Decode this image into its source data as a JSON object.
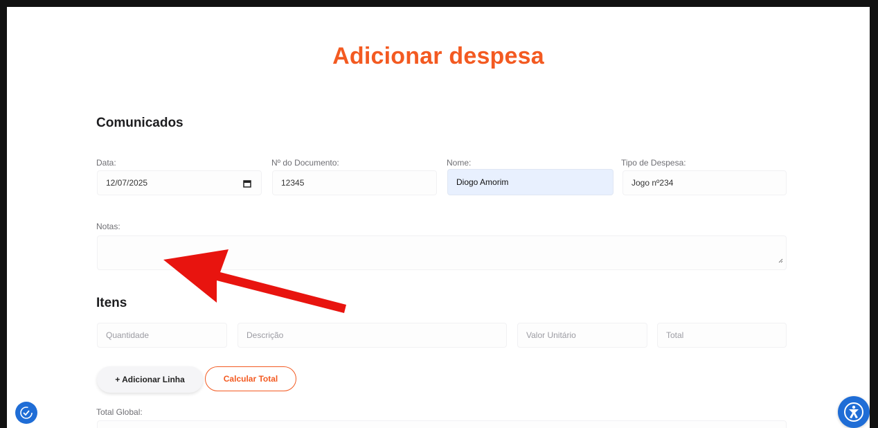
{
  "page": {
    "title": "Adicionar despesa"
  },
  "comunicados": {
    "section_title": "Comunicados",
    "data_label": "Data:",
    "data_value": "12/07/2025",
    "doc_label": "Nº do Documento:",
    "doc_value": "12345",
    "nome_label": "Nome:",
    "nome_value": "Diogo Amorim",
    "tipo_label": "Tipo de Despesa:",
    "tipo_value": "Jogo nº234",
    "notas_label": "Notas:",
    "notas_value": ""
  },
  "itens": {
    "section_title": "Itens",
    "quantidade_placeholder": "Quantidade",
    "descricao_placeholder": "Descrição",
    "valor_unitario_placeholder": "Valor Unitário",
    "total_placeholder": "Total"
  },
  "actions": {
    "add_line_label": "+ Adicionar Linha",
    "calc_total_label": "Calcular Total"
  },
  "total_global": {
    "label": "Total Global:",
    "value": ""
  },
  "icons": {
    "calendar": "calendar-icon",
    "resize": "resize-grip-icon",
    "left_fab": "clock-check-icon",
    "right_fab": "accessibility-icon",
    "annotation": "red-arrow-icon"
  },
  "colors": {
    "accent": "#f35a21",
    "fab_blue": "#1f6dd6",
    "arrow_red": "#e8140f",
    "autofill_bg": "#e8f0fe"
  }
}
